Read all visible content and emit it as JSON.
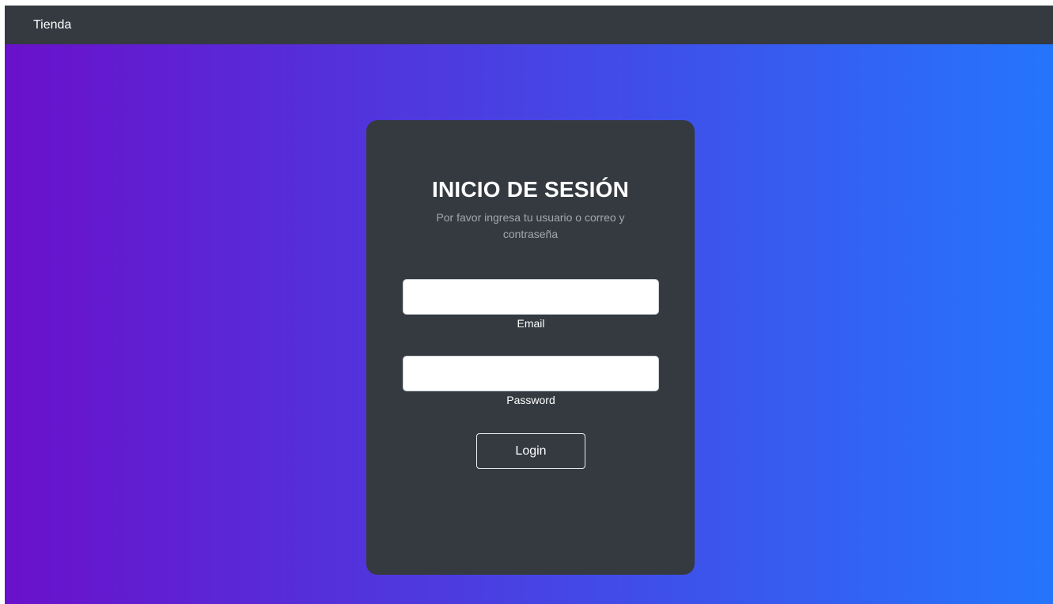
{
  "navbar": {
    "brand": "Tienda"
  },
  "login": {
    "title": "INICIO DE SESIÓN",
    "subtitle": "Por favor ingresa tu usuario o correo y contraseña",
    "email": {
      "label": "Email",
      "value": "",
      "placeholder": ""
    },
    "password": {
      "label": "Password",
      "value": "",
      "placeholder": ""
    },
    "submit_label": "Login"
  },
  "colors": {
    "navbar_bg": "#343a40",
    "gradient_start": "#6a11cb",
    "gradient_end": "#2575fc",
    "card_bg": "#343a40"
  }
}
